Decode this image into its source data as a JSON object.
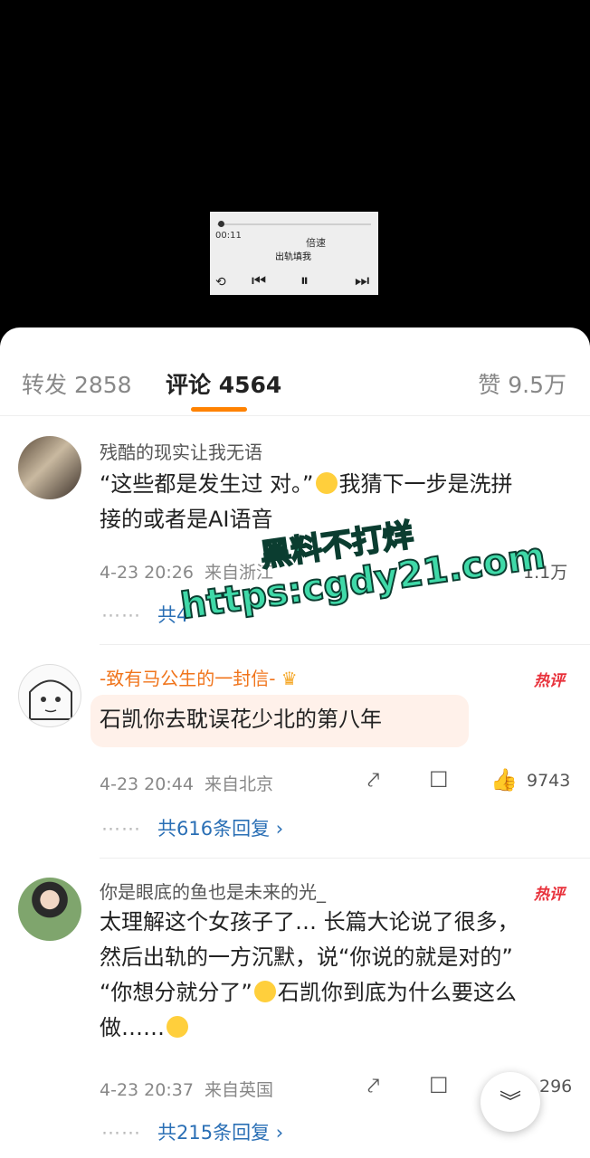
{
  "video": {
    "player_time": "00:11",
    "player_speed": "倍速",
    "subtitle": "出轨填我"
  },
  "tabs": {
    "repost": "转发 2858",
    "comments": "评论 4564",
    "likes": "赞 9.5万"
  },
  "comments": [
    {
      "username": "残酷的现实让我无语",
      "text_line1": "“这些都是发生过 对。”",
      "text_line1b": "我猜下一步是洗拼",
      "text_line2": "接的或者是AI语音",
      "date": "4-23 20:26",
      "source": "来自浙江",
      "likes": "1.1万",
      "replies": "共4",
      "replies_tail": "复"
    },
    {
      "username": "-致有马公生的一封信-",
      "hot_badge": "热评",
      "text": "石凯你去耽误花少北的第八年",
      "date": "4-23 20:44",
      "source": "来自北京",
      "likes": "9743",
      "replies": "共616条回复"
    },
    {
      "username": "你是眼底的鱼也是未来的光_",
      "hot_badge": "热评",
      "text_line1": "太理解这个女孩子了… 长篇大论说了很多，",
      "text_line2": "然后出轨的一方沉默，说“你说的就是对的”",
      "text_line3a": "“你想分就分了”",
      "text_line3b": "石凯你到底为什么要这么",
      "text_line4": "做……",
      "date": "4-23 20:37",
      "source": "来自英国",
      "likes": "296",
      "replies": "共215条回复"
    }
  ],
  "watermark": {
    "line1": "黑料不打烊",
    "line2": "https:cgdy21.com"
  },
  "fab_icon": "chevron-double-down-icon"
}
